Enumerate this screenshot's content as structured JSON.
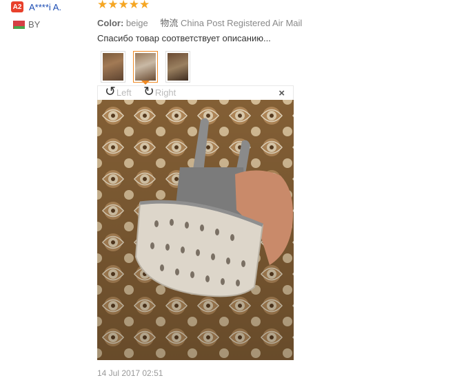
{
  "user": {
    "avatar": "A2",
    "name": "A****i A.",
    "country": "BY"
  },
  "review": {
    "stars": "★★★★★",
    "color_label": "Color:",
    "color_value": "beige",
    "shipping_label": "物流",
    "shipping_value": "China Post Registered Air Mail",
    "text": "Спасибо товар соответствует описанию...",
    "date": "14 Jul 2017 02:51"
  },
  "viewer": {
    "rotate_left": "Left",
    "rotate_right": "Right",
    "close": "×",
    "left_icon": "rotate-ccw-icon",
    "right_icon": "rotate-cw-icon"
  }
}
